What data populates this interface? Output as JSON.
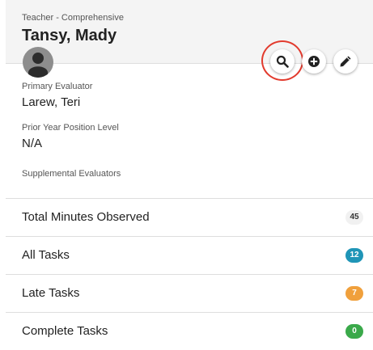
{
  "header": {
    "role": "Teacher - Comprehensive",
    "name": "Tansy, Mady",
    "avatar_icon": "user-silhouette-icon"
  },
  "actions": [
    {
      "name": "search",
      "icon": "magnifier-icon",
      "highlighted": true
    },
    {
      "name": "add",
      "icon": "plus-circle-icon"
    },
    {
      "name": "edit",
      "icon": "pencil-icon"
    }
  ],
  "details": {
    "primary_evaluator_label": "Primary Evaluator",
    "primary_evaluator_value": "Larew, Teri",
    "prior_year_label": "Prior Year Position Level",
    "prior_year_value": "N/A",
    "supplemental_label": "Supplemental Evaluators"
  },
  "stats": [
    {
      "label": "Total Minutes Observed",
      "count": "45",
      "color": "#f1f1f1",
      "text_color": "#333333"
    },
    {
      "label": "All Tasks",
      "count": "12",
      "color": "#1f95b7",
      "text_color": "#ffffff"
    },
    {
      "label": "Late Tasks",
      "count": "7",
      "color": "#f0a03c",
      "text_color": "#ffffff"
    },
    {
      "label": "Complete Tasks",
      "count": "0",
      "color": "#3aa94a",
      "text_color": "#ffffff"
    }
  ],
  "colors": {
    "highlight": "#e23b2e",
    "header_bg": "#f4f4f4"
  }
}
